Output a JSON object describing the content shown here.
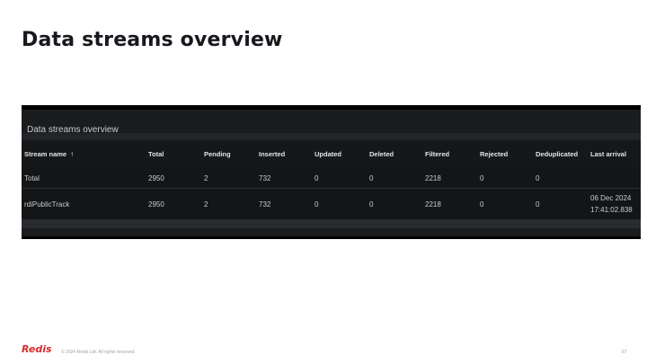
{
  "slide": {
    "title": "Data streams overview"
  },
  "panel": {
    "title": "Data streams overview",
    "columns": [
      "Stream name",
      "Total",
      "Pending",
      "Inserted",
      "Updated",
      "Deleted",
      "Filtered",
      "Rejected",
      "Deduplicated",
      "Last arrival"
    ],
    "sort_icon": "↑",
    "sort_icon_name": "sort-ascending-icon",
    "rows": [
      {
        "stream_name": "Total",
        "total": "2950",
        "pending": "2",
        "inserted": "732",
        "updated": "0",
        "deleted": "0",
        "filtered": "2218",
        "rejected": "0",
        "deduplicated": "0",
        "last_arrival_date": "",
        "last_arrival_time": ""
      },
      {
        "stream_name": "rdiPublicTrack",
        "total": "2950",
        "pending": "2",
        "inserted": "732",
        "updated": "0",
        "deleted": "0",
        "filtered": "2218",
        "rejected": "0",
        "deduplicated": "0",
        "last_arrival_date": "06 Dec 2024",
        "last_arrival_time": "17:41:02.838"
      }
    ]
  },
  "footer": {
    "logo": "Redis",
    "copyright": "© 2024 Redis Ltd. All rights reserved.",
    "page_number": "67"
  },
  "colors": {
    "panel_background": "#111214",
    "brand_red": "#d42c2c",
    "title_text": "#16181d"
  }
}
